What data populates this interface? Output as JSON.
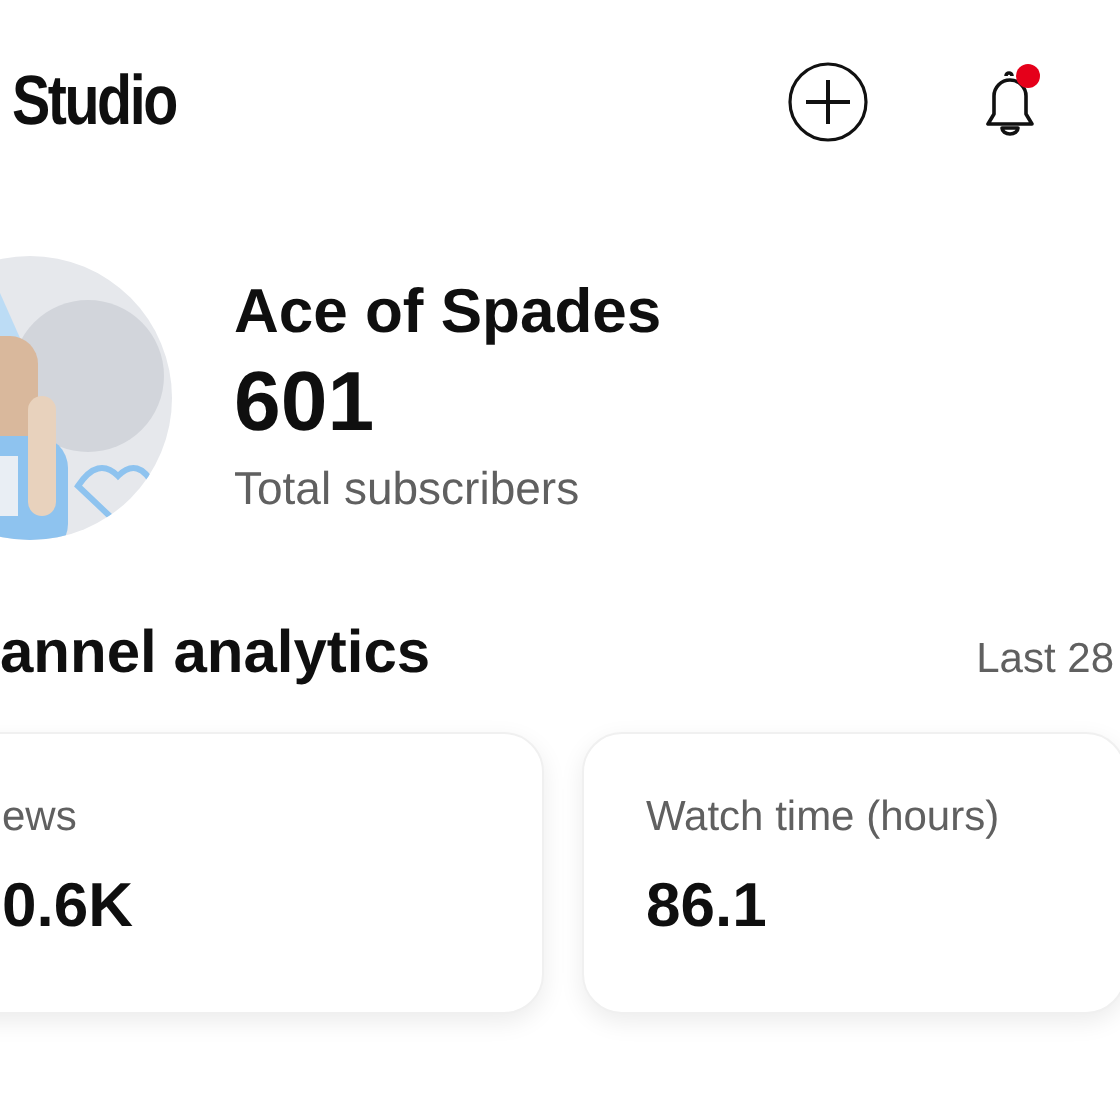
{
  "header": {
    "title": "Studio",
    "notification_badge": true
  },
  "channel": {
    "name": "Ace of Spades",
    "subscribers": "601",
    "subscribers_label": "Total subscribers"
  },
  "analytics": {
    "title": "annel analytics",
    "period": "Last 28",
    "cards": [
      {
        "label": "ews",
        "value": "0.6K"
      },
      {
        "label": "Watch time (hours)",
        "value": "86.1"
      }
    ]
  }
}
